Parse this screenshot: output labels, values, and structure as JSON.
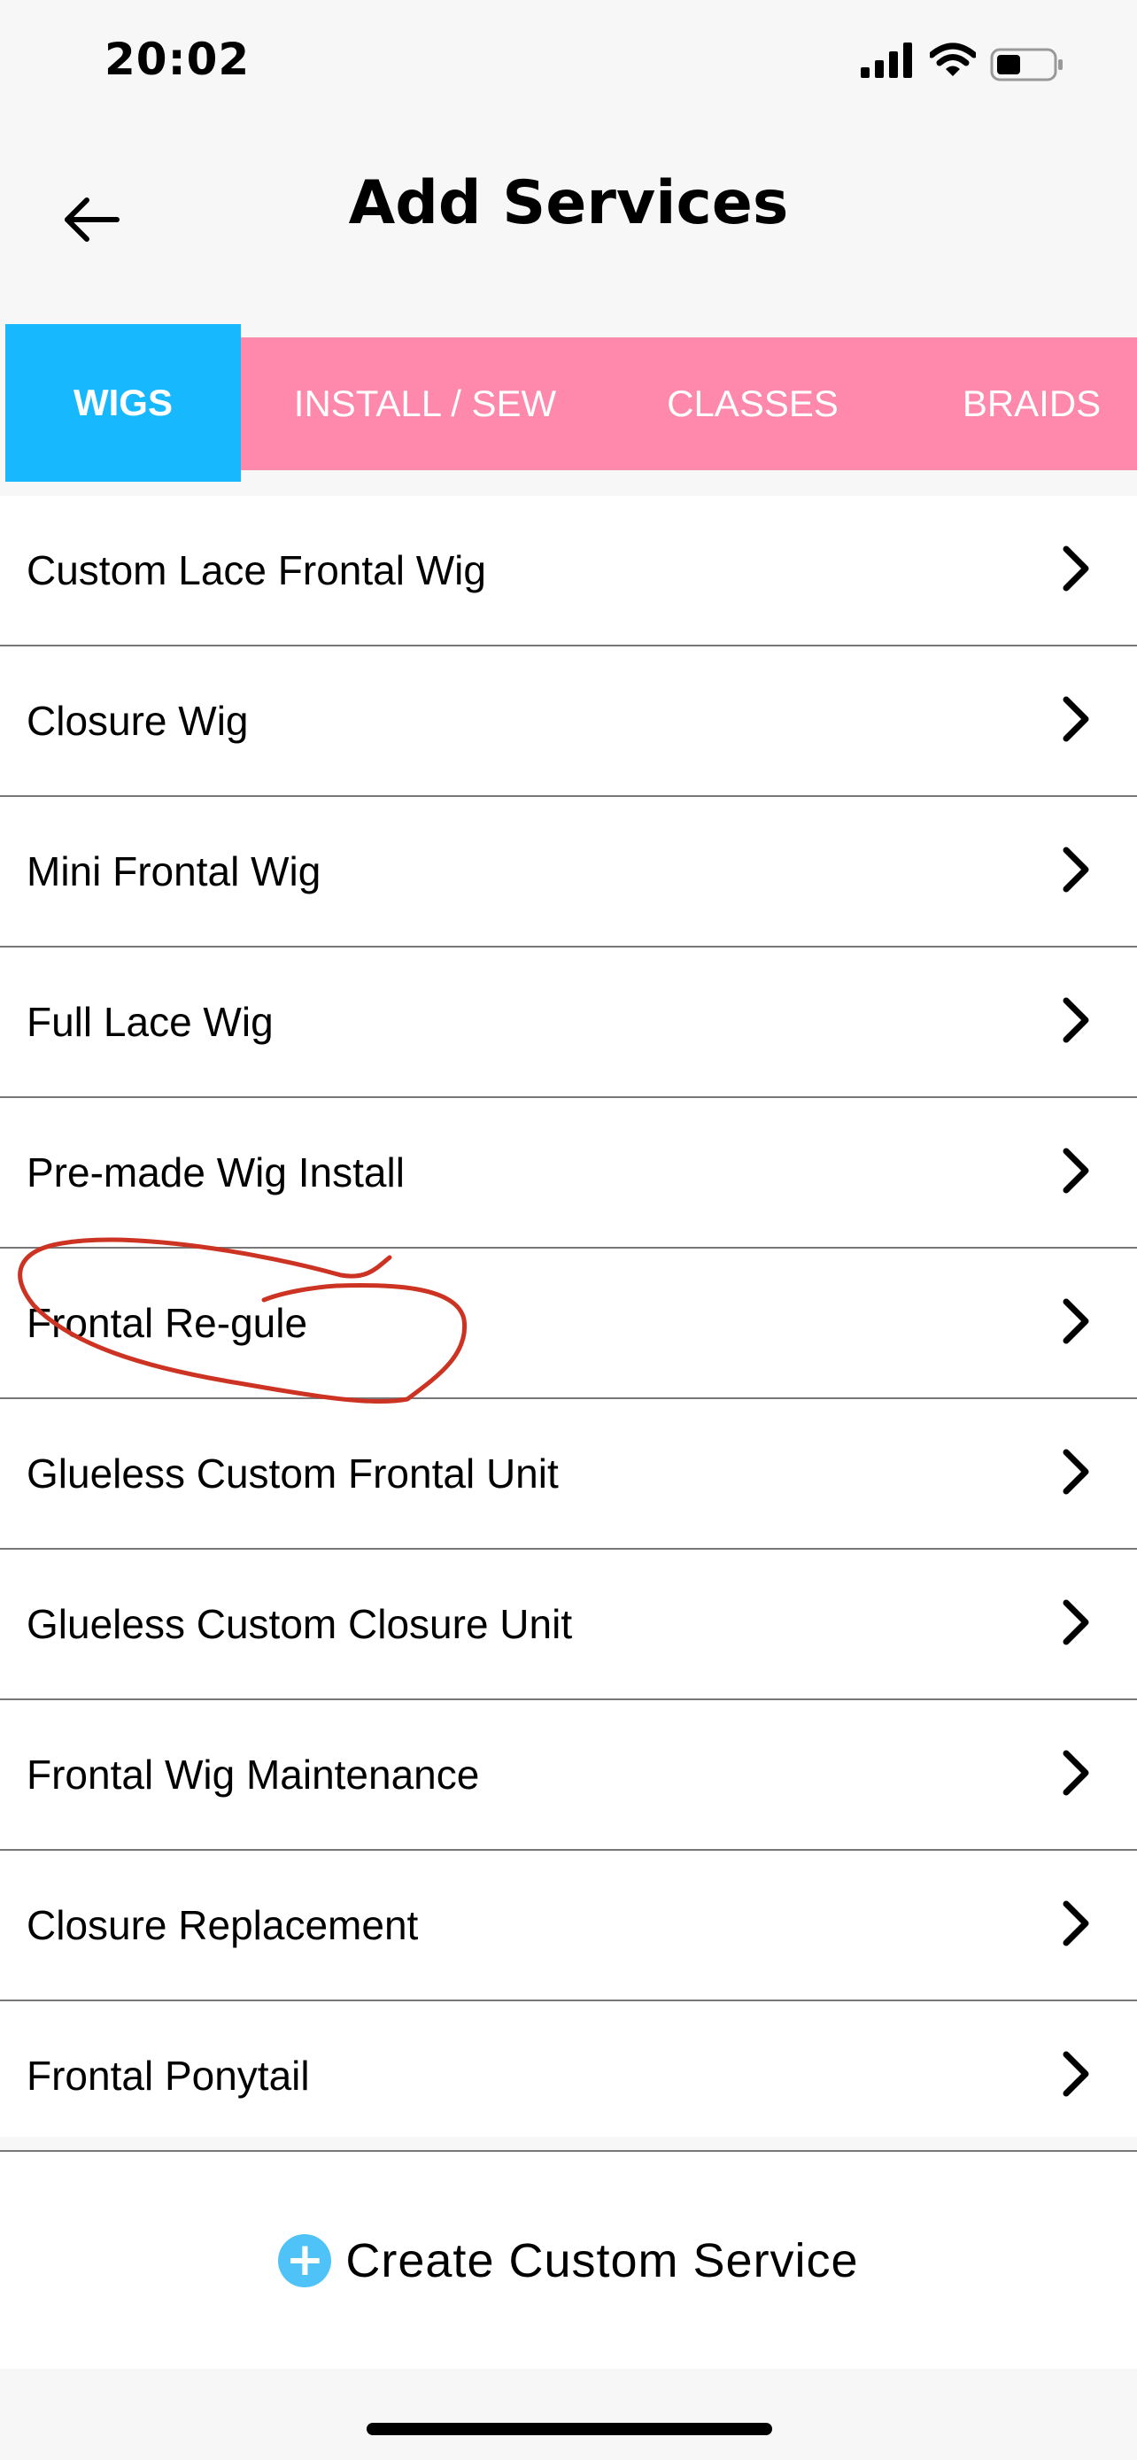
{
  "status_bar": {
    "time": "20:02",
    "icons": [
      "signal-icon",
      "wifi-icon",
      "battery-icon"
    ]
  },
  "header": {
    "back_icon": "arrow-left-icon",
    "title": "Add Services"
  },
  "tabs": [
    {
      "label": "WIGS",
      "active": true
    },
    {
      "label": "INSTALL / SEW",
      "active": false
    },
    {
      "label": "CLASSES",
      "active": false
    },
    {
      "label": "BRAIDS",
      "active": false
    }
  ],
  "colors": {
    "active_tab": "#18b8ff",
    "inactive_tab": "#ff88ad",
    "annotation": "#cc3322",
    "plus_icon": "#4fc3f7"
  },
  "services": [
    "Custom Lace Frontal Wig",
    "Closure Wig",
    "Mini Frontal Wig",
    "Full Lace Wig",
    "Pre-made Wig Install",
    "Frontal Re-gule",
    "Glueless Custom Frontal Unit",
    "Glueless Custom Closure Unit",
    "Frontal Wig Maintenance",
    "Closure Replacement",
    "Frontal Ponytail"
  ],
  "create_custom": {
    "icon": "plus-circle-icon",
    "label": "Create Custom Service"
  }
}
